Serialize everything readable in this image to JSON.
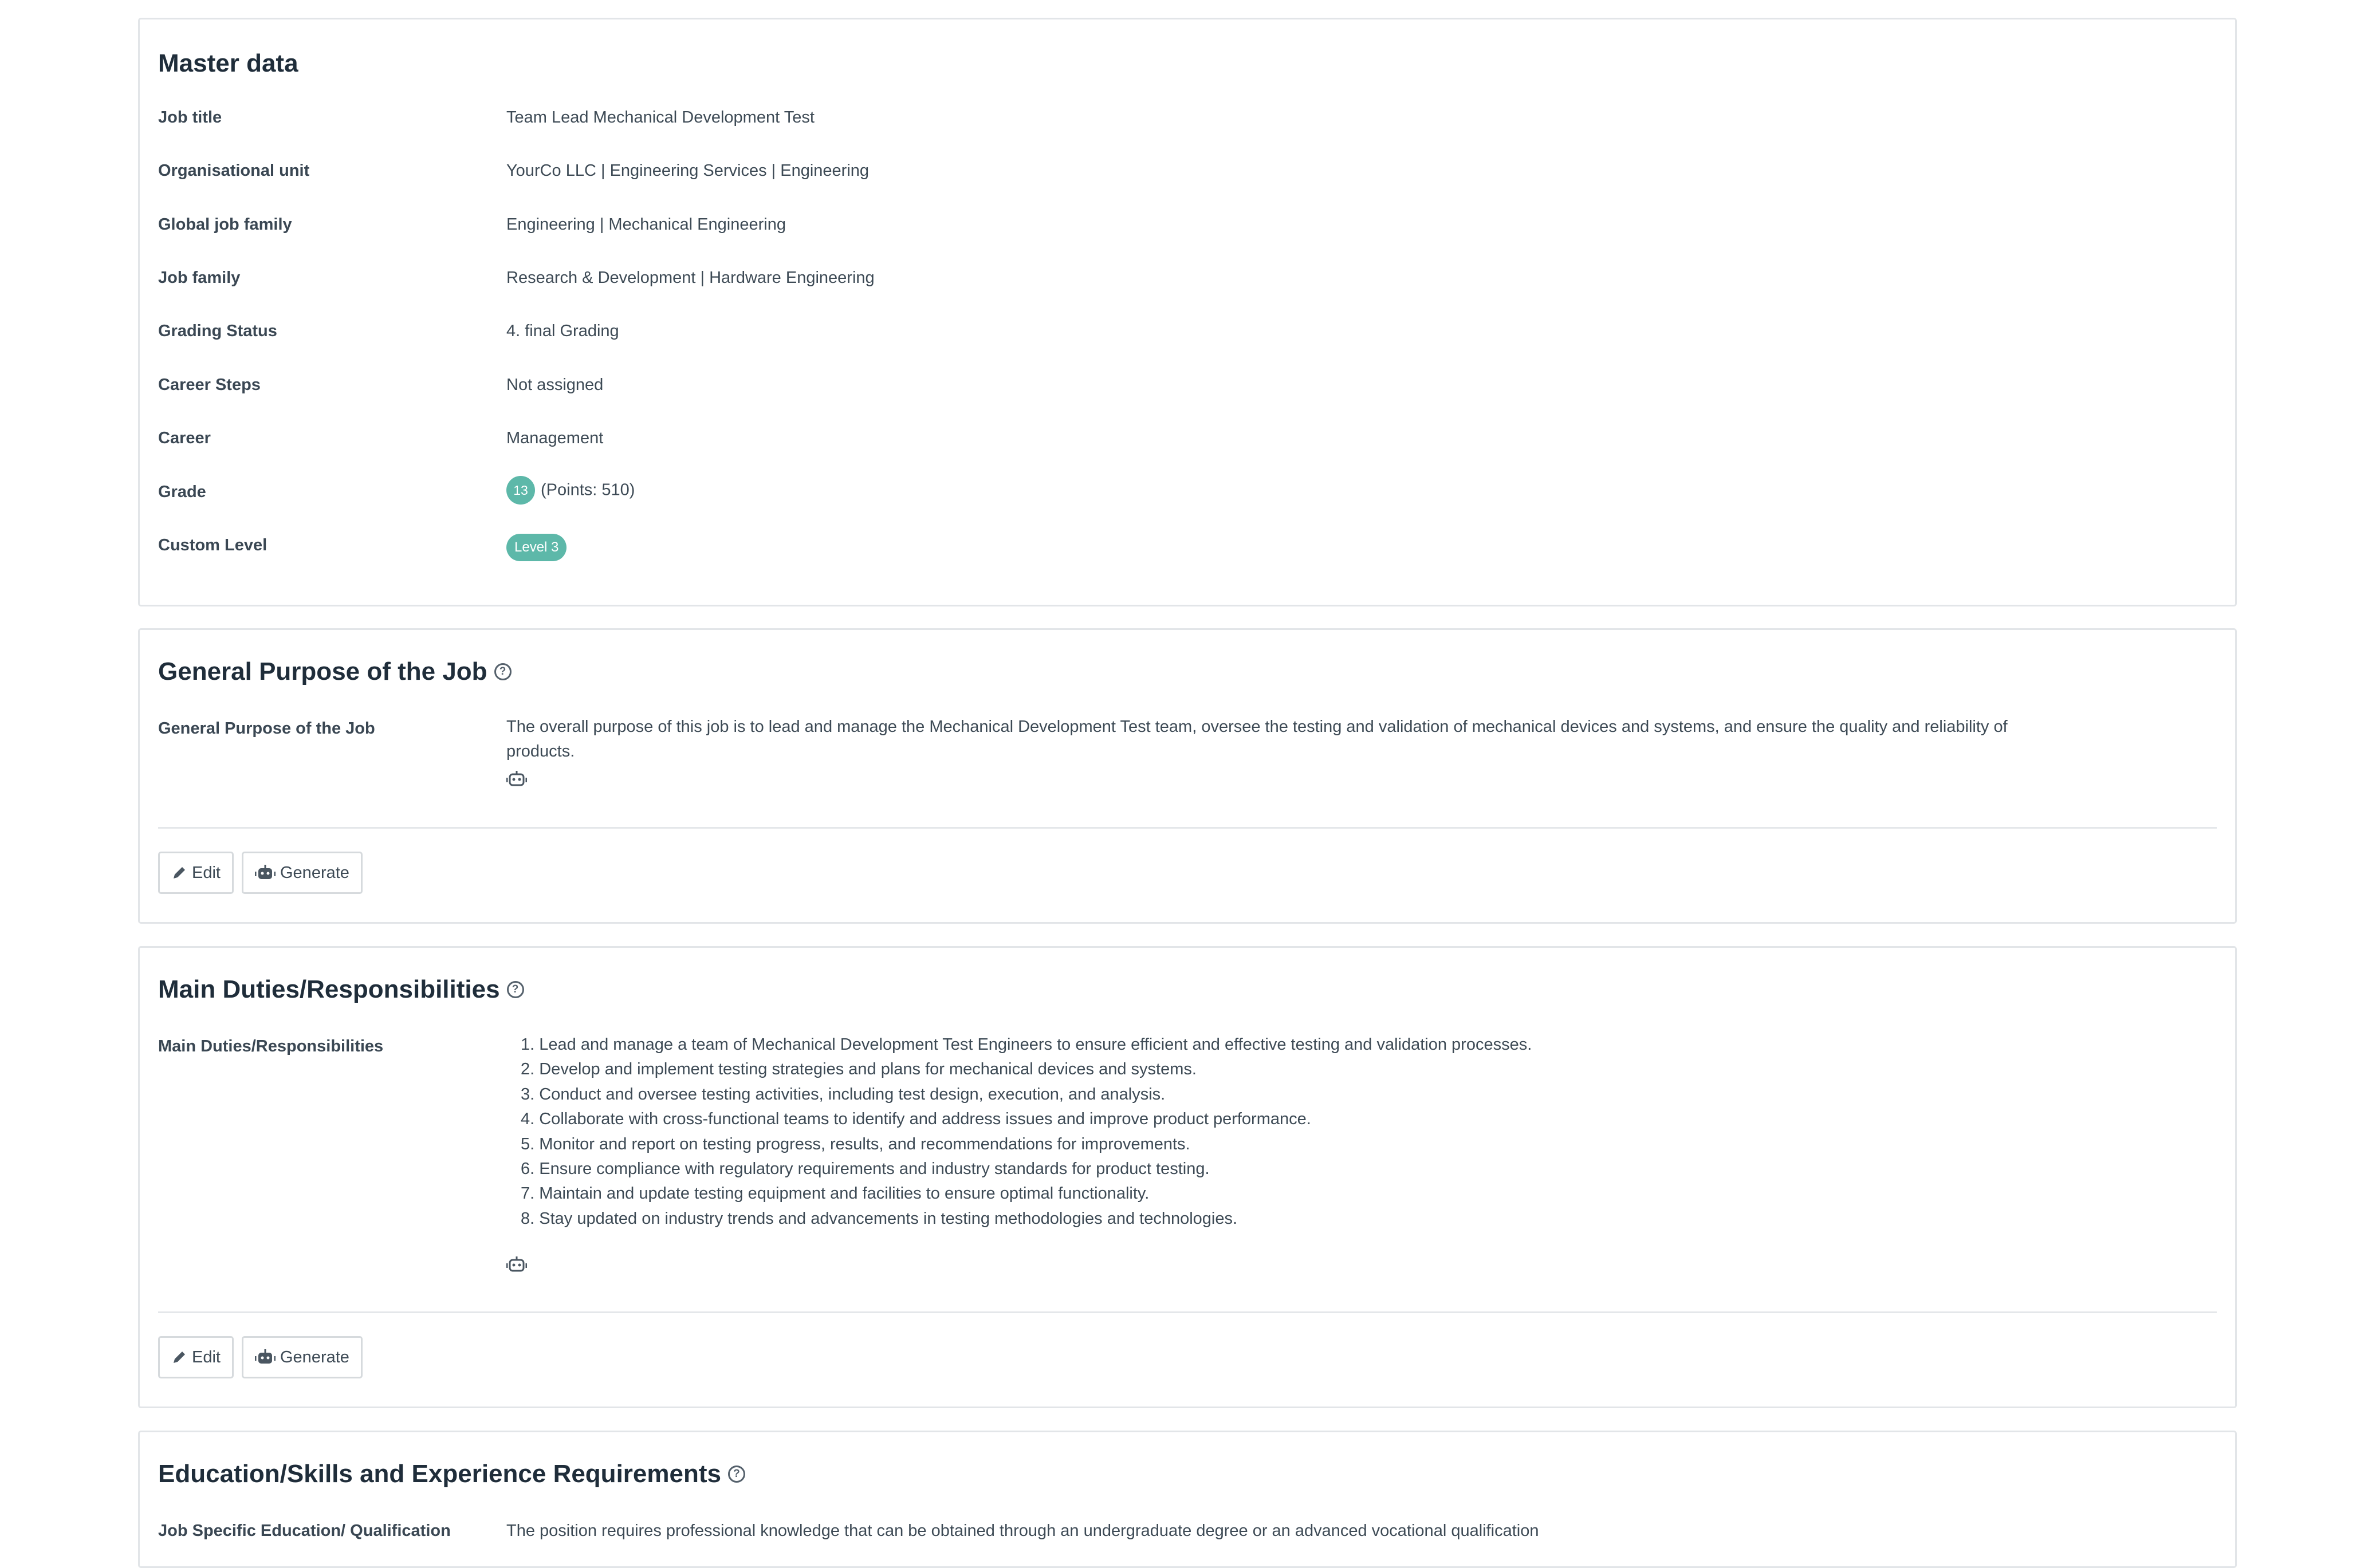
{
  "master": {
    "title": "Master data",
    "rows": [
      {
        "label": "Job title",
        "value": "Team Lead Mechanical Development Test"
      },
      {
        "label": "Organisational unit",
        "value": "YourCo LLC | Engineering Services | Engineering"
      },
      {
        "label": "Global job family",
        "value": "Engineering | Mechanical Engineering"
      },
      {
        "label": "Job family",
        "value": "Research & Development | Hardware Engineering"
      },
      {
        "label": "Grading Status",
        "value": "4. final Grading"
      },
      {
        "label": "Career Steps",
        "value": "Not assigned"
      },
      {
        "label": "Career",
        "value": "Management"
      }
    ],
    "grade": {
      "label": "Grade",
      "badge": "13",
      "points": "(Points: 510)"
    },
    "custom_level": {
      "label": "Custom Level",
      "badge": "Level 3"
    }
  },
  "purpose": {
    "title": "General Purpose of the Job",
    "help_icon": "question-circle-icon",
    "label": "General Purpose of the Job",
    "text": "The overall purpose of this job is to lead and manage the Mechanical Development Test team, oversee the testing and validation of mechanical devices and systems, and ensure the quality and reliability of products.",
    "edit_label": "Edit",
    "generate_label": "Generate"
  },
  "duties": {
    "title": "Main Duties/Responsibilities",
    "help_icon": "question-circle-icon",
    "label": "Main Duties/Responsibilities",
    "items": [
      "1. Lead and manage a team of Mechanical Development Test Engineers to ensure efficient and effective testing and validation processes.",
      "2. Develop and implement testing strategies and plans for mechanical devices and systems.",
      "3. Conduct and oversee testing activities, including test design, execution, and analysis.",
      "4. Collaborate with cross-functional teams to identify and address issues and improve product performance.",
      "5. Monitor and report on testing progress, results, and recommendations for improvements.",
      "6. Ensure compliance with regulatory requirements and industry standards for product testing.",
      "7. Maintain and update testing equipment and facilities to ensure optimal functionality.",
      "8. Stay updated on industry trends and advancements in testing methodologies and technologies."
    ],
    "edit_label": "Edit",
    "generate_label": "Generate"
  },
  "education": {
    "title": "Education/Skills and Experience Requirements",
    "help_icon": "question-circle-icon",
    "label": "Job Specific Education/ Qualification",
    "text": "The position requires professional knowledge that can be obtained through an undergraduate degree or an advanced vocational qualification"
  },
  "colors": {
    "accent": "#5db8a9",
    "border": "#e2e5e8",
    "heading": "#1f2d3a"
  }
}
